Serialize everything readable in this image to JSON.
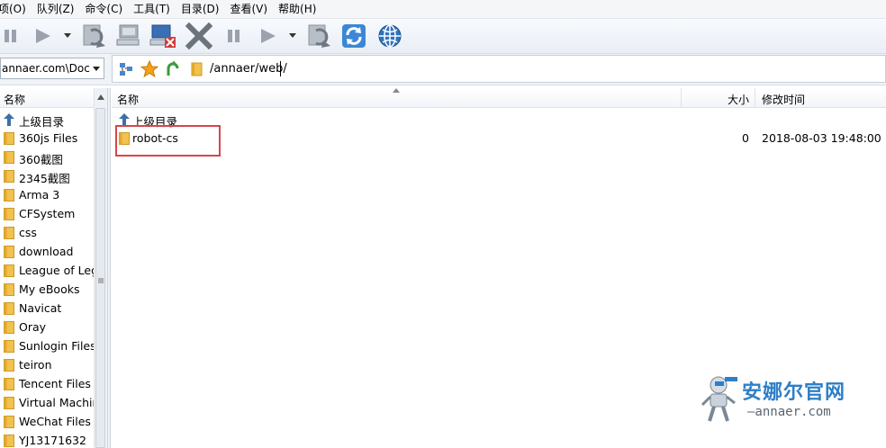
{
  "menu": [
    "项(O)",
    "队列(Z)",
    "命令(C)",
    "工具(T)",
    "目录(D)",
    "查看(V)",
    "帮助(H)"
  ],
  "left_location": "annaer.com\\Doc",
  "remote_path": "/annaer/web/",
  "left_header": {
    "name": "名称"
  },
  "right_header": {
    "name": "名称",
    "size": "大小",
    "modified": "修改时间"
  },
  "left_items": [
    {
      "label": "上级目录",
      "icon": "up-arrow-icon"
    },
    {
      "label": "360js Files",
      "icon": "folder-icon"
    },
    {
      "label": "360截图",
      "icon": "folder-icon"
    },
    {
      "label": "2345截图",
      "icon": "folder-icon"
    },
    {
      "label": "Arma 3",
      "icon": "folder-icon"
    },
    {
      "label": "CFSystem",
      "icon": "folder-icon"
    },
    {
      "label": "css",
      "icon": "folder-icon"
    },
    {
      "label": "download",
      "icon": "folder-icon"
    },
    {
      "label": "League of Leg",
      "icon": "folder-icon"
    },
    {
      "label": "My eBooks",
      "icon": "folder-icon"
    },
    {
      "label": "Navicat",
      "icon": "folder-icon"
    },
    {
      "label": "Oray",
      "icon": "folder-icon"
    },
    {
      "label": "Sunlogin Files",
      "icon": "folder-icon"
    },
    {
      "label": "teiron",
      "icon": "folder-icon"
    },
    {
      "label": "Tencent Files",
      "icon": "folder-icon"
    },
    {
      "label": "Virtual Machin",
      "icon": "folder-icon"
    },
    {
      "label": "WeChat Files",
      "icon": "folder-icon"
    },
    {
      "label": "YJ13171632",
      "icon": "folder-icon"
    }
  ],
  "right_items": [
    {
      "name": "上级目录",
      "size": "",
      "modified": "",
      "icon": "up-arrow-icon"
    },
    {
      "name": "robot-cs",
      "size": "0",
      "modified": "2018-08-03 19:48:00",
      "icon": "folder-icon"
    }
  ],
  "watermark": {
    "title": "安娜尔官网",
    "domain": "—annaer.com"
  },
  "colors": {
    "folder": "#f2c14e",
    "highlight_box": "#d9444b",
    "watermark": "#2d7fc7"
  }
}
